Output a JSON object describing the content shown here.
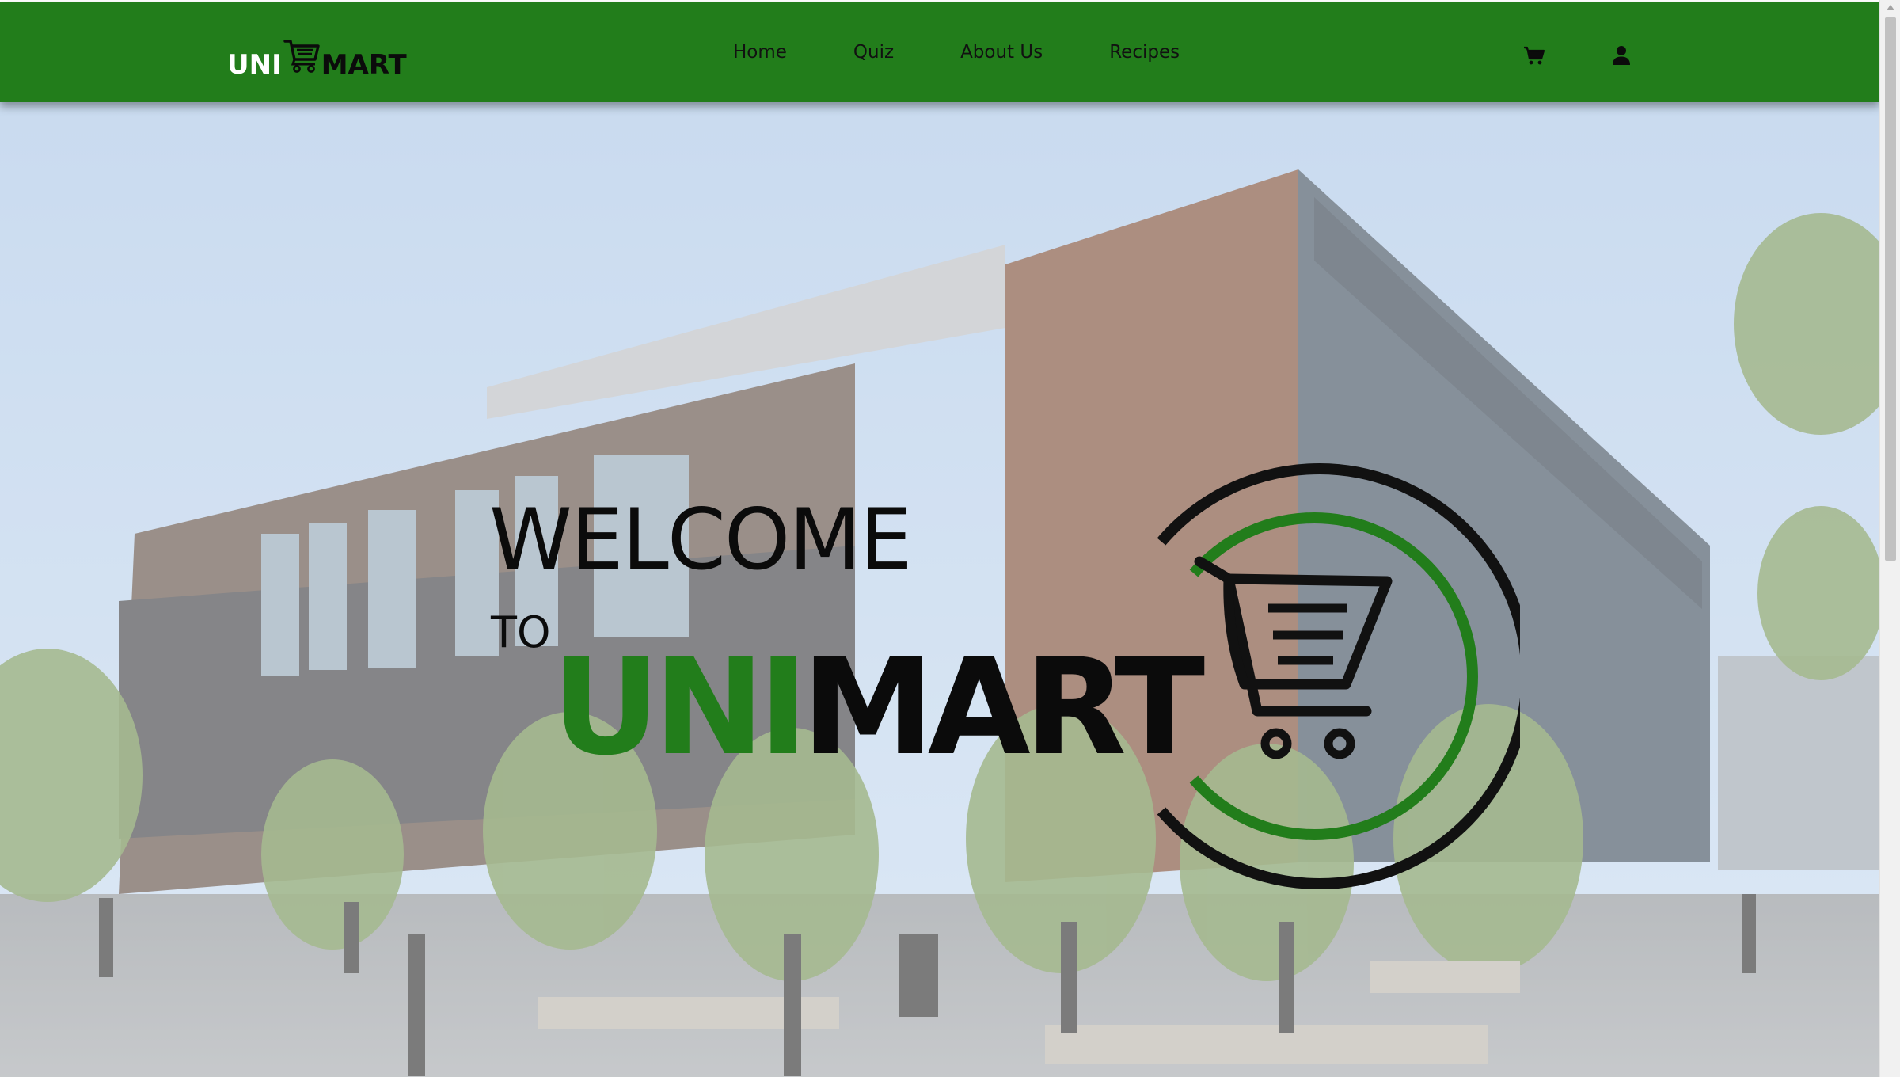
{
  "navbar": {
    "logo": {
      "part1": "UNI",
      "part2": "MART",
      "icon": "cart-icon"
    },
    "links": [
      {
        "label": "Home"
      },
      {
        "label": "Quiz"
      },
      {
        "label": "About Us"
      },
      {
        "label": "Recipes"
      }
    ],
    "cart_icon": "cart-icon",
    "user_icon": "user-icon"
  },
  "hero": {
    "background": "campus building photo",
    "welcome": "WELCOME",
    "to": "TO",
    "brand_part1": "UNI",
    "brand_part2": "MART",
    "emblem_icon": "shopping-cart-ring-icon"
  },
  "colors": {
    "brand_green": "#227d1b",
    "text_dark": "#0b0b0b",
    "white": "#ffffff"
  }
}
